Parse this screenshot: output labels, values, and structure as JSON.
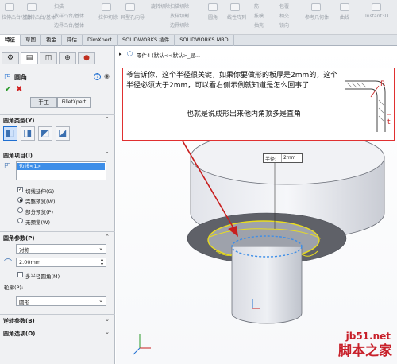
{
  "toolbar": {
    "groups": [
      {
        "label": "拉伸凸台/基体"
      },
      {
        "label": "旋转凸台/基体"
      },
      {
        "label": "扫描"
      },
      {
        "label": "放样凸台/基体"
      },
      {
        "label": "边界凸台/基体"
      },
      {
        "label": "拉伸切除"
      },
      {
        "label": "异型孔向导"
      },
      {
        "label": "旋转切除"
      },
      {
        "label": "扫描切除"
      },
      {
        "label": "放样切割"
      },
      {
        "label": "边界切除"
      },
      {
        "label": "圆角"
      },
      {
        "label": "线性阵列"
      },
      {
        "label": "筋"
      },
      {
        "label": "拔模"
      },
      {
        "label": "抽壳"
      },
      {
        "label": "包覆"
      },
      {
        "label": "相交"
      },
      {
        "label": "镜向"
      },
      {
        "label": "参考几何体"
      },
      {
        "label": "曲线"
      },
      {
        "label": "Instant3D"
      }
    ]
  },
  "tabs": [
    "特征",
    "草图",
    "钣金",
    "评估",
    "DimXpert",
    "SOLIDWORKS 插件",
    "SOLIDWORKS MBD"
  ],
  "breadcrumb": "零件4 (默认<<默认>_显...",
  "panel": {
    "title": "圆角",
    "help": "?",
    "manual_tab": "手工",
    "filletxpert_tab": "FilletXpert",
    "fillet_type": "圆角类型(Y)",
    "fillet_items": "圆角项目(I)",
    "selected_item": "边线<1>",
    "tangent_prop": "切线延伸(G)",
    "full_preview": "完整预览(W)",
    "partial_preview": "部分预览(P)",
    "no_preview": "无预览(W)",
    "fillet_params": "圆角参数(P)",
    "symmetric": "对称",
    "radius_value": "2.00mm",
    "multi_radius": "多半径圆角(M)",
    "profile_label": "轮廓(P):",
    "profile_value": "圆形",
    "setback": "逆转参数(B)",
    "options": "圆角选项(O)"
  },
  "viewport": {
    "annotation": "爷告诉你，这个半径很关键，如果你要做形的板厚是2mm的，这个半径必须大于2mm，可以看右侧示例就知道是怎么回事了",
    "annotation_sub": "也就是说成形出来他内角顶多是直角",
    "callout_label": "半径:",
    "callout_value": "2mm",
    "sketch_r": "R",
    "sketch_t": "t"
  },
  "watermark": {
    "url": "jb51.net",
    "name": "脚本之家"
  },
  "colors": {
    "accent": "#1f6fd1",
    "annotation_border": "#e03030",
    "highlight": "#f0e020"
  }
}
